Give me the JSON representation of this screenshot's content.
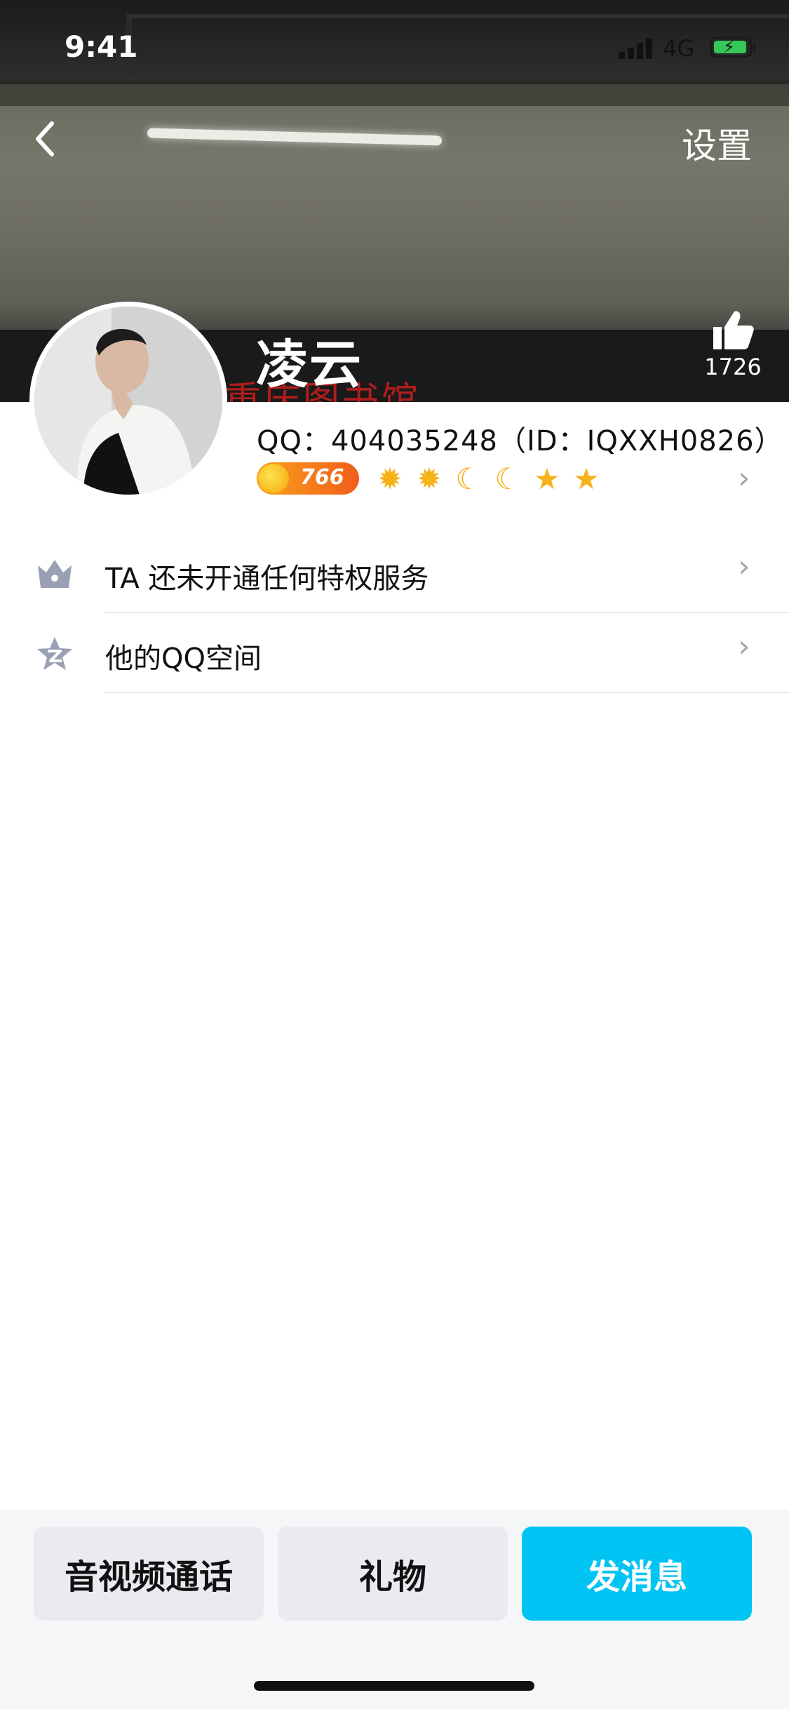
{
  "status": {
    "time": "9:41",
    "network": "4G"
  },
  "header": {
    "settings_label": "设置",
    "cover_sign_text": "重庆图书馆"
  },
  "profile": {
    "name": "凌云",
    "likes": "1726",
    "qq_line": "QQ：404035248（ID：IQXXH0826）",
    "level_number": "766",
    "level_badges": [
      "sun-icon",
      "sun-icon",
      "moon-icon",
      "moon-icon",
      "star-icon",
      "star-icon"
    ]
  },
  "list": [
    {
      "icon": "crown-icon",
      "label": "TA 还未开通任何特权服务"
    },
    {
      "icon": "qzone-star-icon",
      "label": "他的QQ空间"
    }
  ],
  "actions": {
    "call_label": "音视频通话",
    "gift_label": "礼物",
    "message_label": "发消息"
  },
  "colors": {
    "primary_button": "#00c4f4",
    "secondary_button": "#e9ebf1",
    "level_coin": "#f57a1a"
  }
}
